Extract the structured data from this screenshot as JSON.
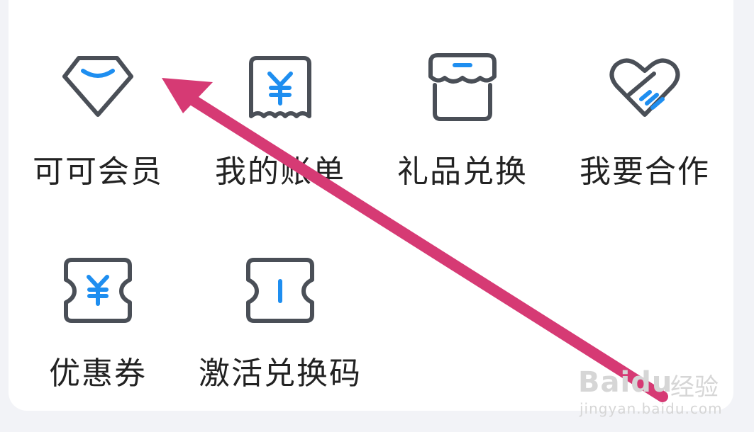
{
  "menu": {
    "items": [
      {
        "label": "可可会员",
        "icon": "diamond-icon"
      },
      {
        "label": "我的账单",
        "icon": "bill-yen-icon"
      },
      {
        "label": "礼品兑换",
        "icon": "gift-box-icon"
      },
      {
        "label": "我要合作",
        "icon": "heart-handshake-icon"
      },
      {
        "label": "优惠券",
        "icon": "coupon-yen-icon"
      },
      {
        "label": "激活兑换码",
        "icon": "ticket-icon"
      }
    ]
  },
  "watermark": {
    "brand": "Baidu",
    "text": "经验",
    "url": "jingyan.baidu.com"
  },
  "colors": {
    "icon_stroke": "#4a4f57",
    "icon_accent": "#1e8ef0",
    "annotation_arrow": "#d63a74",
    "background": "#f2f3f7"
  }
}
